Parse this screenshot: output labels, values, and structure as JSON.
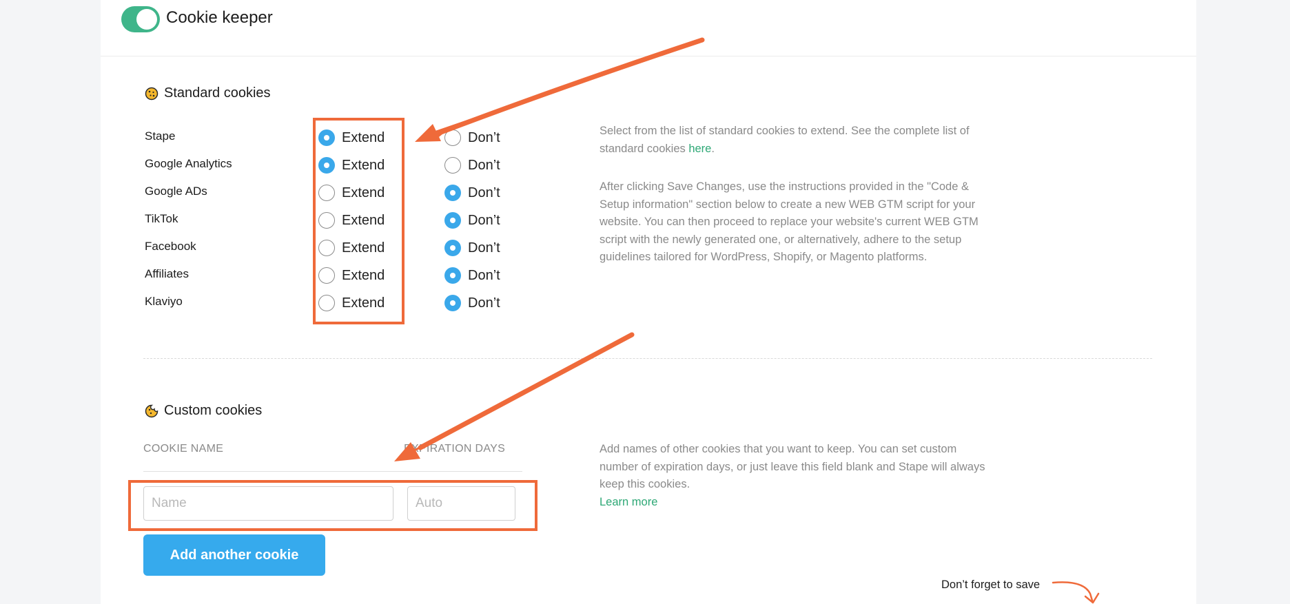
{
  "header": {
    "title": "Cookie keeper",
    "toggle_on": true
  },
  "standard": {
    "title": "Standard cookies",
    "option_extend": "Extend",
    "option_dont": "Don’t",
    "rows": [
      {
        "label": "Stape",
        "selected": "extend"
      },
      {
        "label": "Google Analytics",
        "selected": "extend"
      },
      {
        "label": "Google ADs",
        "selected": "dont"
      },
      {
        "label": "TikTok",
        "selected": "dont"
      },
      {
        "label": "Facebook",
        "selected": "dont"
      },
      {
        "label": "Affiliates",
        "selected": "dont"
      },
      {
        "label": "Klaviyo",
        "selected": "dont"
      }
    ],
    "desc1_text": "Select from the list of standard cookies to extend. See the complete list of standard cookies ",
    "desc1_link": "here",
    "desc1_end": ".",
    "desc2": "After clicking Save Changes, use the instructions provided in the \"Code & Setup information\" section below to create a new WEB GTM script for your website. You can then proceed to replace your website's current WEB GTM script with the newly generated one, or alternatively, adhere to the setup guidelines tailored for WordPress, Shopify, or Magento platforms."
  },
  "custom": {
    "title": "Custom cookies",
    "col_name": "COOKIE NAME",
    "col_days": "EXPIRATION DAYS",
    "name_placeholder": "Name",
    "days_placeholder": "Auto",
    "add_button": "Add another cookie",
    "desc": "Add names of other cookies that you want to keep. You can set custom number of expiration days, or just leave this field blank and Stape will always keep this cookies.",
    "learn_more": "Learn more"
  },
  "footer": {
    "save_note": "Don’t forget to save"
  },
  "colors": {
    "accent_green": "#3fb58a",
    "radio_blue": "#3aa8ea",
    "annotation_orange": "#ef6a3a",
    "button_blue": "#36aaed"
  }
}
